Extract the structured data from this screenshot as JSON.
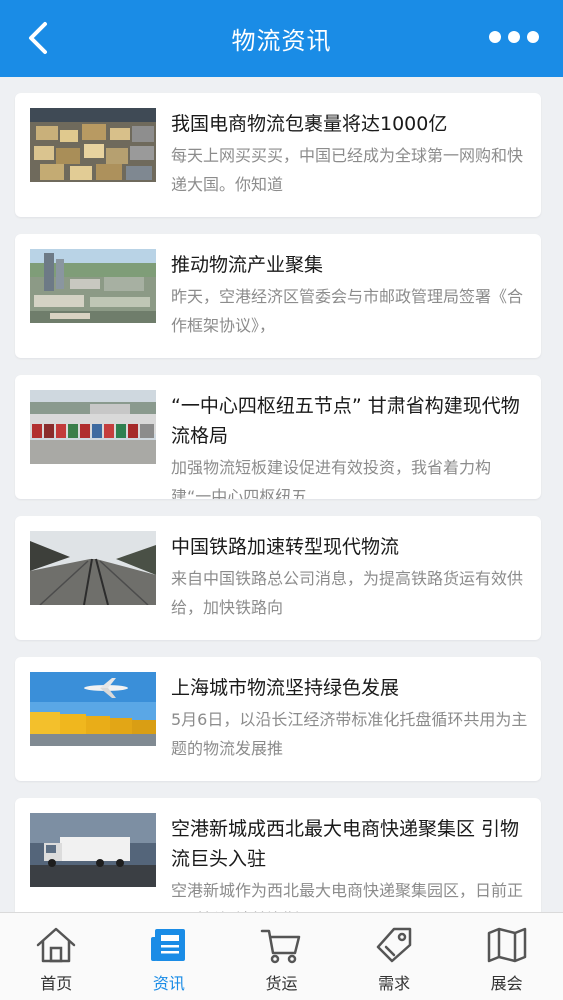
{
  "header": {
    "title": "物流资讯",
    "back_icon": "chevron-left-icon",
    "more_icon": "more-dots-icon"
  },
  "articles": [
    {
      "title": "我国电商物流包裹量将达1000亿",
      "summary": "每天上网买买买，中国已经成为全球第一网购和快递大国。你知道",
      "thumb": "parcels-photo"
    },
    {
      "title": "推动物流产业聚集",
      "summary": "昨天，空港经济区管委会与市邮政管理局签署《合作框架协议》，",
      "thumb": "city-aerial-photo"
    },
    {
      "title": "“一中心四枢纽五节点” 甘肃省构建现代物流格局",
      "summary": "加强物流短板建设促进有效投资，我省着力构建“一中心四枢纽五",
      "thumb": "truck-yard-photo"
    },
    {
      "title": "中国铁路加速转型现代物流",
      "summary": "来自中国铁路总公司消息，为提高铁路货运有效供给，加快铁路向",
      "thumb": "railway-photo"
    },
    {
      "title": "上海城市物流坚持绿色发展",
      "summary": "5月6日，以沿长江经济带标准化托盘循环共用为主题的物流发展推",
      "thumb": "airplane-trucks-photo"
    },
    {
      "title": "空港新城成西北最大电商快递聚集区 引物流巨头入驻",
      "summary": "空港新城作为西北最大电商快递聚集园区，日前正吸引新加坡普洛斯",
      "thumb": "truck-highway-photo"
    }
  ],
  "tabs": [
    {
      "label": "首页",
      "icon": "home-icon",
      "active": false
    },
    {
      "label": "资讯",
      "icon": "news-icon",
      "active": true
    },
    {
      "label": "货运",
      "icon": "cart-icon",
      "active": false
    },
    {
      "label": "需求",
      "icon": "tag-icon",
      "active": false
    },
    {
      "label": "展会",
      "icon": "map-icon",
      "active": false
    }
  ],
  "colors": {
    "accent": "#1a8ce6",
    "background": "#eef0f3",
    "card": "#ffffff",
    "headline": "#1a1a1a",
    "summary": "#8c8c8c"
  }
}
